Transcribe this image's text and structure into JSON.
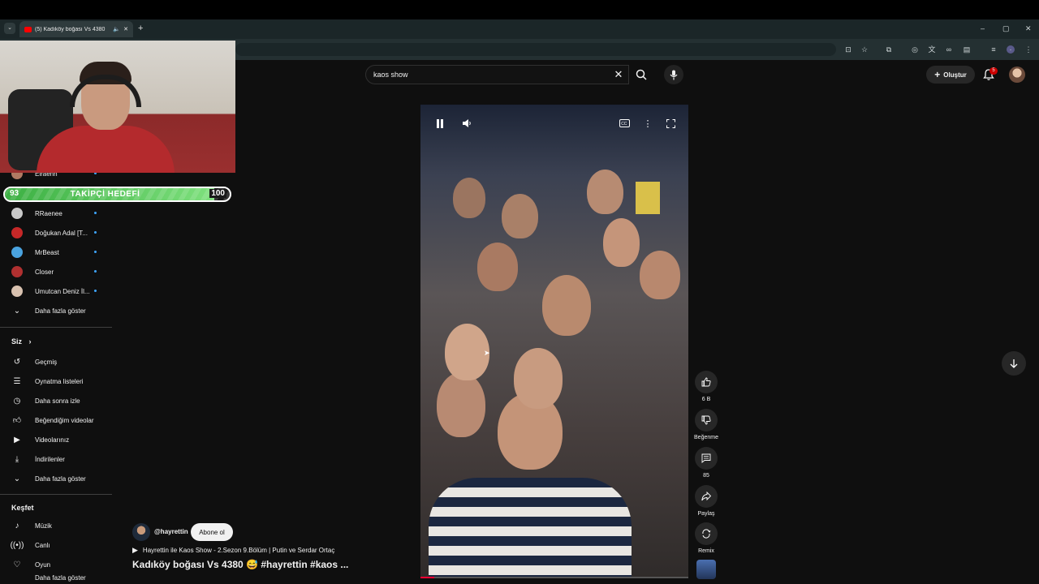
{
  "browser": {
    "tab_title": "(5) Kadıköy boğası Vs 4380",
    "new_tab": "+",
    "window_controls": [
      "–",
      "▢",
      "✕"
    ]
  },
  "overlay": {
    "goal_title": "TAKİPÇİ HEDEFİ",
    "goal_current": "93",
    "goal_target": "100",
    "goal_progress": 0.93
  },
  "sidebar": {
    "subscriptions": [
      {
        "label": "Elraenn",
        "avatar_color": "#b07a63"
      },
      {
        "label": "RRaenee",
        "avatar_color": "#c9c9c9"
      },
      {
        "label": "Doğukan Adal [T...",
        "avatar_color": "#c62828"
      },
      {
        "label": "MrBeast",
        "avatar_color": "#4aa3df"
      },
      {
        "label": "Closer",
        "avatar_color": "#b03030"
      },
      {
        "label": "Umutcan Deniz İl...",
        "avatar_color": "#d9c2b0"
      }
    ],
    "show_more_1": "Daha fazla göster",
    "you_title": "Siz",
    "you_items": [
      {
        "label": "Geçmiş",
        "icon": "history-icon"
      },
      {
        "label": "Oynatma listeleri",
        "icon": "playlists-icon"
      },
      {
        "label": "Daha sonra izle",
        "icon": "watch-later-icon"
      },
      {
        "label": "Beğendiğim videolar",
        "icon": "liked-icon"
      },
      {
        "label": "Videolarınız",
        "icon": "your-videos-icon"
      },
      {
        "label": "İndirilenler",
        "icon": "downloads-icon"
      }
    ],
    "show_more_2": "Daha fazla göster",
    "explore_title": "Keşfet",
    "explore_items": [
      {
        "label": "Müzik",
        "icon": "music-icon"
      },
      {
        "label": "Canlı",
        "icon": "live-icon"
      },
      {
        "label": "Oyun",
        "icon": "gaming-icon"
      }
    ],
    "show_more_3": "Daha fazla göster"
  },
  "header": {
    "search_value": "kaos show",
    "create_label": "Oluştur",
    "notification_count": "5"
  },
  "player": {
    "progress": 0.05
  },
  "actions": {
    "like_count": "6 B",
    "dislike_label": "Beğenme",
    "comment_count": "85",
    "share_label": "Paylaş",
    "remix_label": "Remix"
  },
  "video": {
    "channel": "@hayrettin",
    "subscribe_label": "Abone ol",
    "playlist": "Hayrettin ile Kaos Show - 2.Sezon 9.Bölüm | Putin ve Serdar Ortaç",
    "title": "Kadıköy boğası Vs 4380 😅 #hayrettin #kaos ..."
  }
}
